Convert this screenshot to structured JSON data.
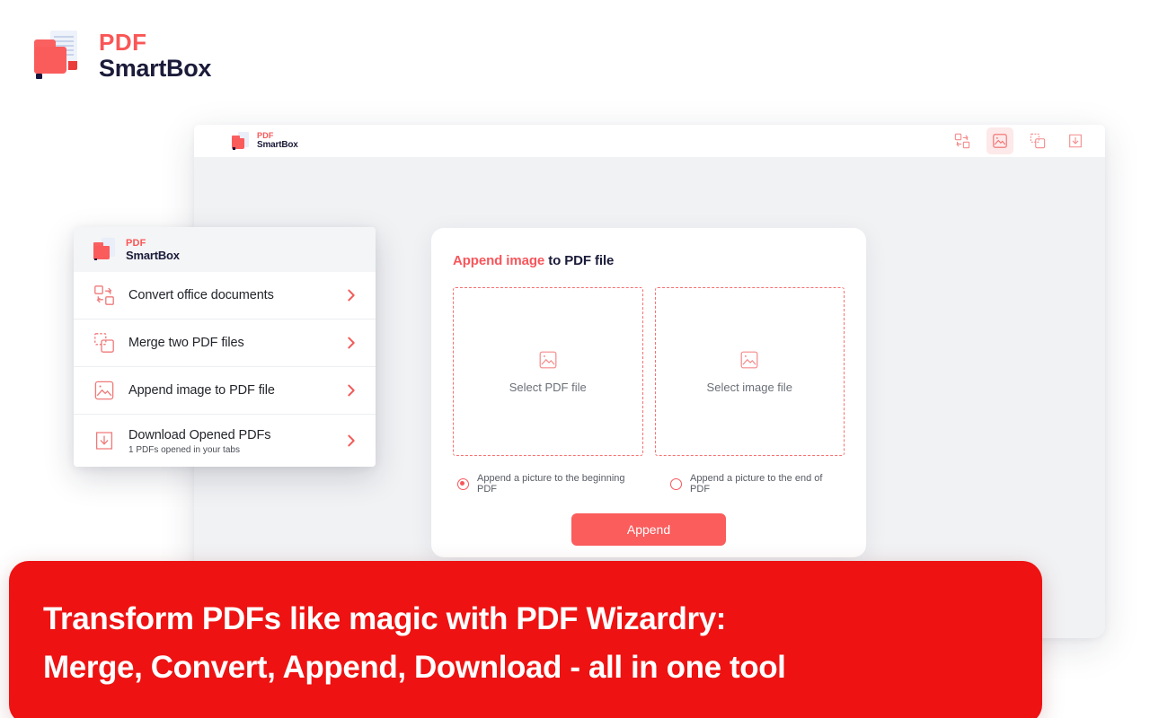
{
  "brand": {
    "line1": "PDF",
    "line2": "SmartBox",
    "logo_icon": "pdf-folder-logo-icon",
    "accent_color": "#fa5656",
    "dark_color": "#1b1b3a"
  },
  "app_window": {
    "header": {
      "brand_line1": "PDF",
      "brand_line2": "SmartBox",
      "toolbar": [
        {
          "name": "convert-office-documents-icon",
          "label": "Convert office documents",
          "active": false
        },
        {
          "name": "append-image-icon",
          "label": "Append image to PDF file",
          "active": true
        },
        {
          "name": "merge-pdf-icon",
          "label": "Merge two PDF files",
          "active": false
        },
        {
          "name": "download-pdf-icon",
          "label": "Download Opened PDFs",
          "active": false
        }
      ]
    },
    "card": {
      "title_accent": "Append image",
      "title_rest": " to PDF file",
      "dropzones": [
        {
          "icon": "image-placeholder-icon",
          "label": "Select PDF file"
        },
        {
          "icon": "image-placeholder-icon",
          "label": "Select image file"
        }
      ],
      "radio_options": [
        {
          "label": "Append a picture to the beginning PDF",
          "checked": true
        },
        {
          "label": "Append a picture to the end of PDF",
          "checked": false
        }
      ],
      "submit_label": "Append",
      "submit_color": "#fb5c5c"
    }
  },
  "menu_panel": {
    "brand_line1": "PDF",
    "brand_line2": "SmartBox",
    "items": [
      {
        "icon": "convert-office-documents-icon",
        "title": "Convert office documents",
        "subtitle": "",
        "chevron": "chevron-right-icon"
      },
      {
        "icon": "merge-pdf-icon",
        "title": "Merge two PDF files",
        "subtitle": "",
        "chevron": "chevron-right-icon"
      },
      {
        "icon": "append-image-icon",
        "title": "Append image to PDF file",
        "subtitle": "",
        "chevron": "chevron-right-icon"
      },
      {
        "icon": "download-pdf-icon",
        "title": "Download Opened PDFs",
        "subtitle": "1 PDFs opened in your tabs",
        "chevron": "chevron-right-icon"
      }
    ]
  },
  "banner": {
    "line1": "Transform PDFs like magic with PDF Wizardry:",
    "line2": "Merge, Convert, Append, Download - all in one tool",
    "background_color": "#ee1212",
    "text_color": "#ffffff"
  }
}
